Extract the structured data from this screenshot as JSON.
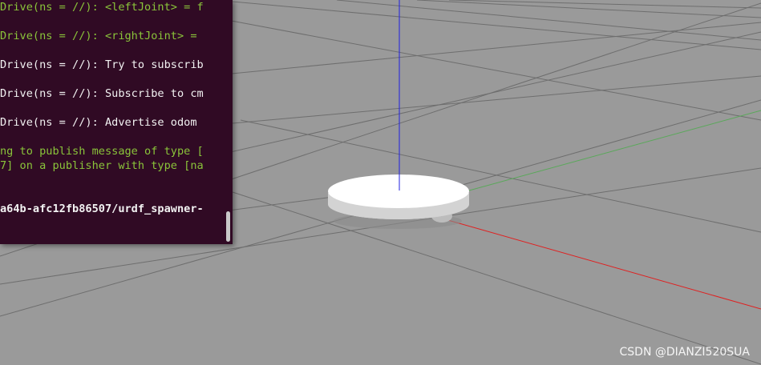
{
  "terminal": {
    "lines": [
      {
        "text": "Drive(ns = //): <leftJoint> = f",
        "color": "#8ac43a"
      },
      {
        "text": "Drive(ns = //): <rightJoint> =",
        "color": "#8ac43a"
      },
      {
        "text": "Drive(ns = //): Try to subscrib",
        "color": "#f2f2f2"
      },
      {
        "text": "Drive(ns = //): Subscribe to cm",
        "color": "#f2f2f2"
      },
      {
        "text": "Drive(ns = //): Advertise odom",
        "color": "#f2f2f2"
      },
      {
        "text": "ng to publish message of type [",
        "color": "#8ac43a"
      },
      {
        "text": "7] on a publisher with type [na",
        "color": "#8ac43a"
      },
      {
        "text": "a64b-afc12fb86507/urdf_spawner-",
        "color": "#f2f2f2"
      }
    ]
  },
  "watermark": "CSDN @DIANZI520SUA",
  "colors": {
    "ground": "#9a9a9a",
    "grid": "#6e6e6e",
    "axis_x": "#e02020",
    "axis_y": "#5aa85a",
    "axis_z": "#2020e0",
    "robot_top": "#ffffff",
    "robot_side": "#cfcfcf"
  }
}
